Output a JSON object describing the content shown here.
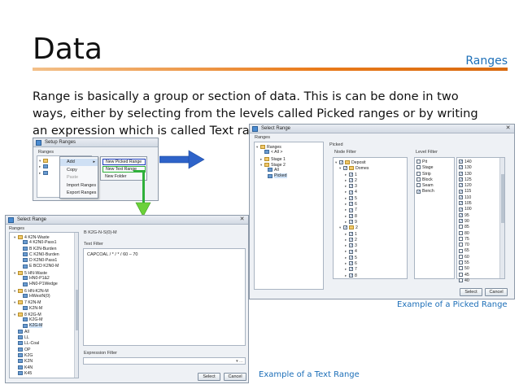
{
  "slide": {
    "title": "Data",
    "section": "Ranges",
    "body": "Range is basically a group or section of data. This is can be done in two ways, either by selecting from the levels called Picked ranges or by writing an expression which is called Text range."
  },
  "captions": {
    "picked": "Example of a Picked Range",
    "text": "Example of a Text Range"
  },
  "colors": {
    "accent_blue": "#1d6fb8",
    "rule_orange": "#e97a1a",
    "highlight_blue": "#1f3fbf",
    "highlight_green": "#2fb03a",
    "arrow_blue": "#2e63c9",
    "arrow_green": "#6bd13a"
  },
  "setup_ranges": {
    "title": "Setup Ranges",
    "group_label": "Ranges",
    "context_menu": [
      "Add",
      "Copy",
      "Paste",
      "Import Ranges",
      "Export Ranges"
    ],
    "submenu": [
      "New Picked Range",
      "New Text Range",
      "New Folder"
    ]
  },
  "picked_dialog": {
    "title": "Select Range",
    "left_group": "Ranges",
    "right_group": "Picked",
    "tree": [
      "Ranges",
      "< All >",
      "Stage 1",
      "Stage 2",
      "All",
      "Picked"
    ],
    "node_filter": {
      "label": "Node Filter",
      "rows": [
        "Deposit",
        "Domes",
        "1",
        "2",
        "3",
        "4",
        "5",
        "6",
        "7",
        "8",
        "9",
        "2",
        "1",
        "2",
        "3",
        "4",
        "5",
        "6",
        "7",
        "8"
      ]
    },
    "level_filter": {
      "label": "Level Filter",
      "names": [
        "Pit",
        "Stage",
        "Strip",
        "Block",
        "Seam",
        "Bench"
      ],
      "values": [
        "140",
        "130",
        "130",
        "125",
        "120",
        "115",
        "110",
        "105",
        "100",
        "95",
        "90",
        "85",
        "80",
        "75",
        "70",
        "65",
        "60",
        "55",
        "50",
        "45",
        "40"
      ]
    },
    "buttons": {
      "select": "Select",
      "cancel": "Cancel"
    }
  },
  "text_dialog": {
    "title": "Select Range",
    "left_group": "Ranges",
    "right_header": "B K2G-N-S(0)-M",
    "tree": [
      "4 K2N-Waste",
      "4 K2N0-Pass1",
      "B K2N-Burden",
      "C K2N0-Burden",
      "D K2N0-Pass1",
      "E BCD K2N0-M",
      "5 HN-Waste",
      "HN0-P1&2",
      "HN0-P1Wedge",
      "6 HN-K2N-M",
      "HWestN(0)",
      "7 K2N-M",
      "K2N-M",
      "8 K2G-M",
      "K2G-M",
      "K2G-M",
      "All",
      "LL",
      "LL-Coal",
      "OP",
      "K2G",
      "K2N",
      "K4N",
      "K45"
    ],
    "text_filter_label": "Text Filter",
    "text_filter_value": "CAPCOAL / * / * / 60 – 70",
    "expression_filter_label": "Expression Filter",
    "buttons": {
      "select": "Select",
      "cancel": "Cancel"
    }
  }
}
